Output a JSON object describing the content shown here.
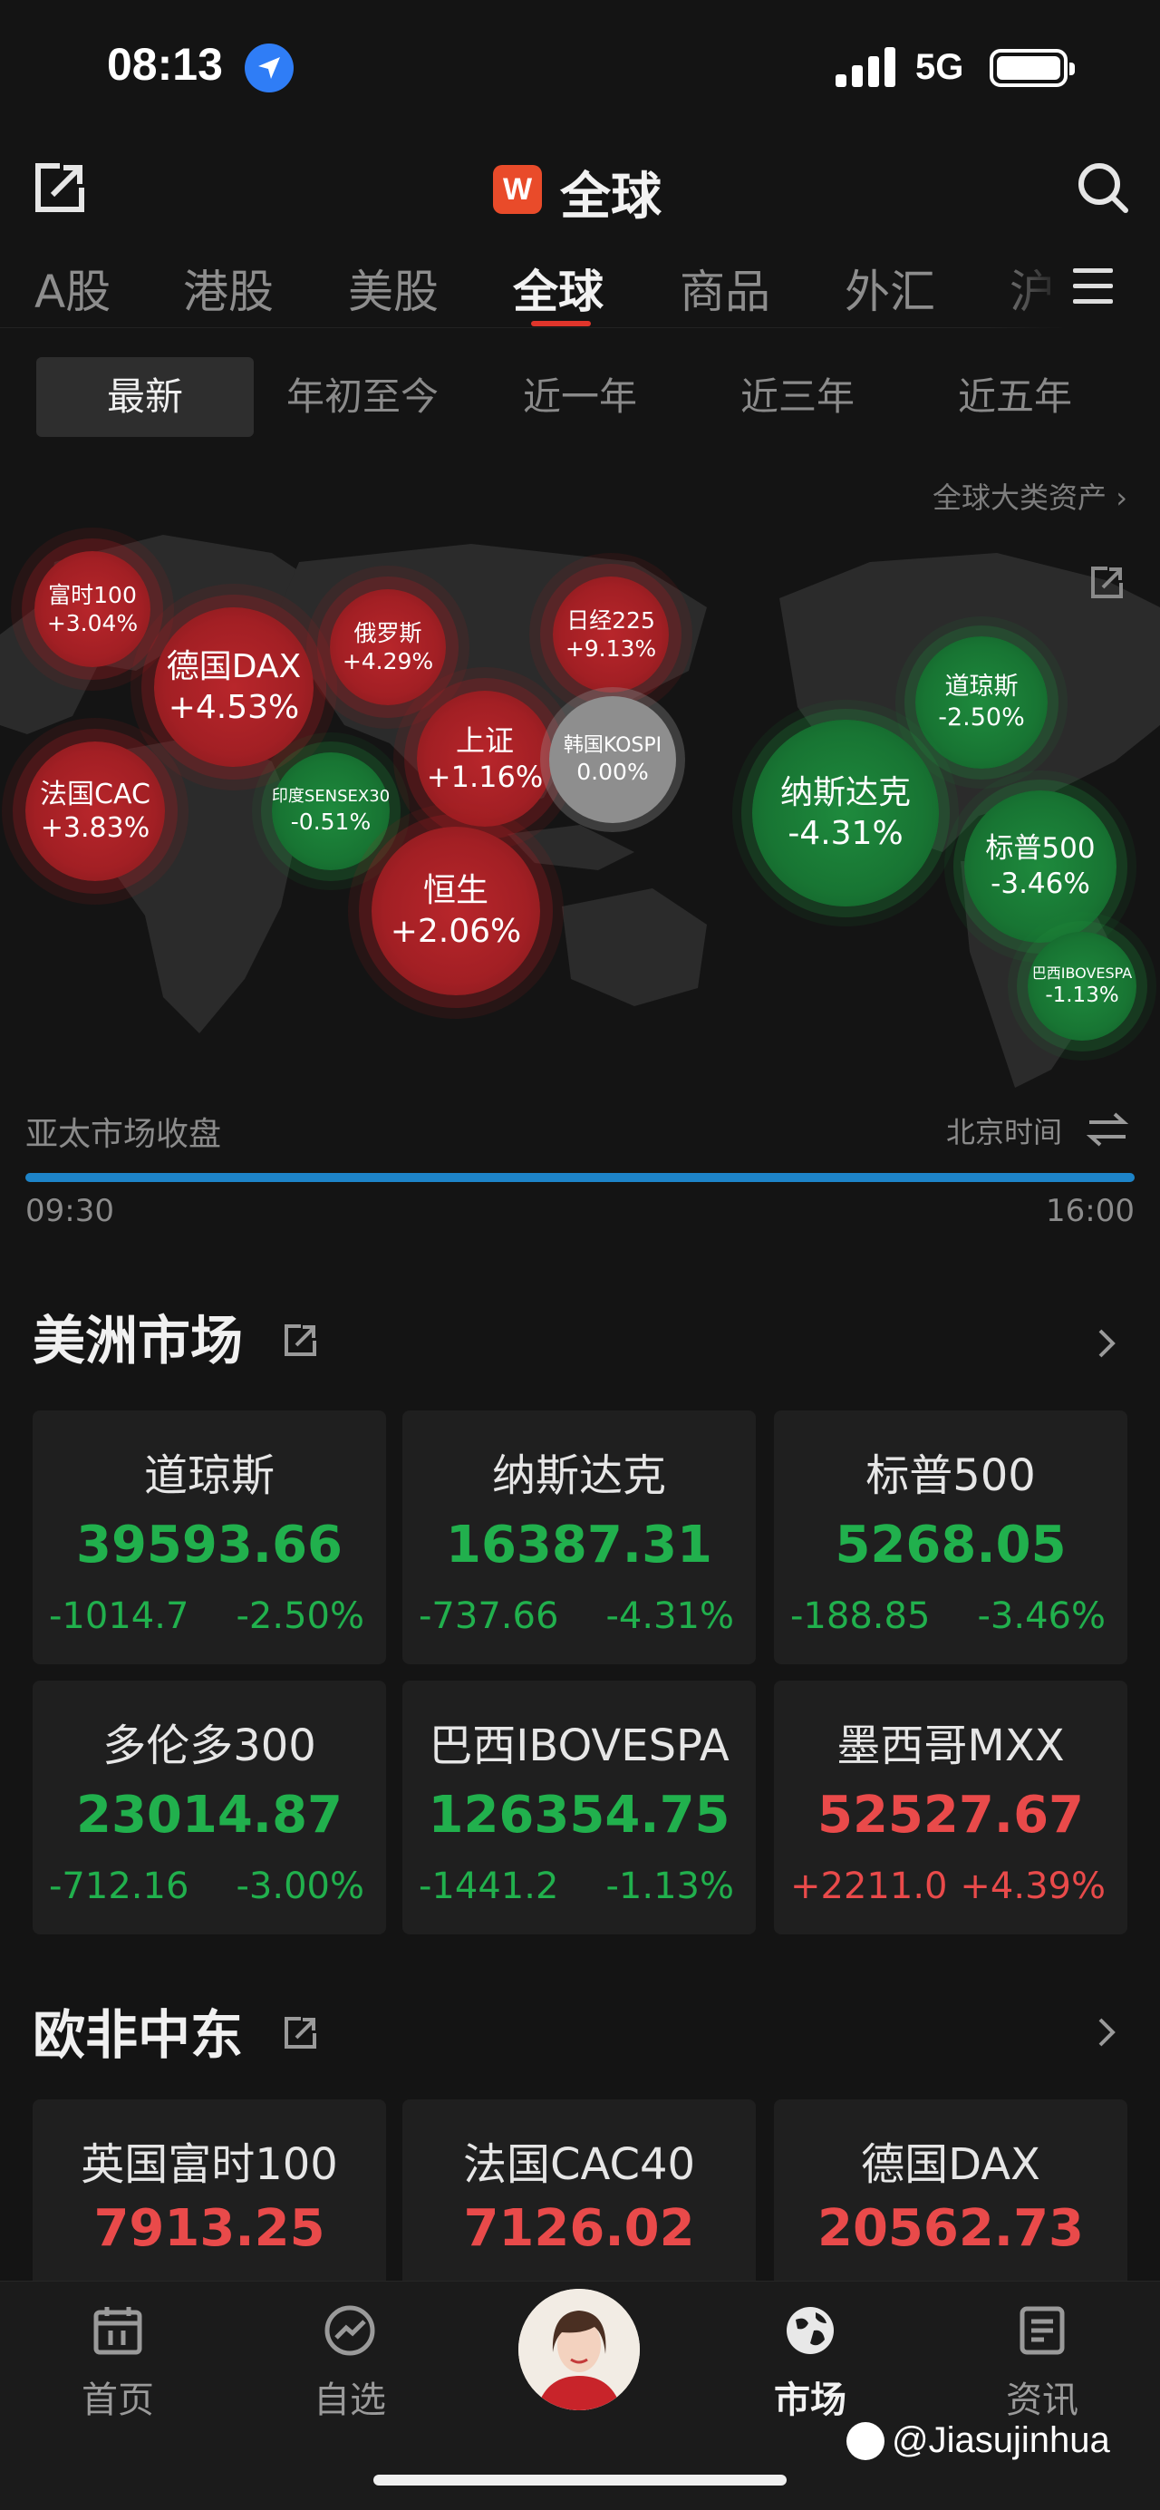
{
  "status_bar": {
    "time": "08:13",
    "network": "5G"
  },
  "header": {
    "brand_letter": "W",
    "title": "全球"
  },
  "market_tabs": [
    {
      "label": "A股",
      "active": false
    },
    {
      "label": "港股",
      "active": false
    },
    {
      "label": "美股",
      "active": false
    },
    {
      "label": "全球",
      "active": true
    },
    {
      "label": "商品",
      "active": false
    },
    {
      "label": "外汇",
      "active": false
    },
    {
      "label": "沪",
      "active": false
    }
  ],
  "periods": [
    {
      "label": "最新",
      "active": true
    },
    {
      "label": "年初至今",
      "active": false
    },
    {
      "label": "近一年",
      "active": false
    },
    {
      "label": "近三年",
      "active": false
    },
    {
      "label": "近五年",
      "active": false
    }
  ],
  "asset_link": "全球大类资产 ›",
  "map_indices": [
    {
      "name": "富时100",
      "change": "+3.04%",
      "trend": "up"
    },
    {
      "name": "德国DAX",
      "change": "+4.53%",
      "trend": "up"
    },
    {
      "name": "俄罗斯",
      "change": "+4.29%",
      "trend": "up"
    },
    {
      "name": "日经225",
      "change": "+9.13%",
      "trend": "up"
    },
    {
      "name": "法国CAC",
      "change": "+3.83%",
      "trend": "up"
    },
    {
      "name": "印度SENSEX30",
      "change": "-0.51%",
      "trend": "down"
    },
    {
      "name": "上证",
      "change": "+1.16%",
      "trend": "up"
    },
    {
      "name": "韩国KOSPI",
      "change": "0.00%",
      "trend": "flat"
    },
    {
      "name": "恒生",
      "change": "+2.06%",
      "trend": "up"
    },
    {
      "name": "道琼斯",
      "change": "-2.50%",
      "trend": "down"
    },
    {
      "name": "纳斯达克",
      "change": "-4.31%",
      "trend": "down"
    },
    {
      "name": "标普500",
      "change": "-3.46%",
      "trend": "down"
    },
    {
      "name": "巴西IBOVESPA",
      "change": "-1.13%",
      "trend": "down"
    }
  ],
  "session": {
    "label": "亚太市场收盘",
    "clock_label": "北京时间",
    "open_time": "09:30",
    "close_time": "16:00",
    "progress": 1.0
  },
  "americas": {
    "title": "美洲市场",
    "cards": [
      {
        "name": "道琼斯",
        "price": "39593.66",
        "change": "-1014.7",
        "pct": "-2.50%",
        "trend": "down"
      },
      {
        "name": "纳斯达克",
        "price": "16387.31",
        "change": "-737.66",
        "pct": "-4.31%",
        "trend": "down"
      },
      {
        "name": "标普500",
        "price": "5268.05",
        "change": "-188.85",
        "pct": "-3.46%",
        "trend": "down"
      },
      {
        "name": "多伦多300",
        "price": "23014.87",
        "change": "-712.16",
        "pct": "-3.00%",
        "trend": "down"
      },
      {
        "name": "巴西IBOVESPA",
        "price": "126354.75",
        "change": "-1441.2",
        "pct": "-1.13%",
        "trend": "down"
      },
      {
        "name": "墨西哥MXX",
        "price": "52527.67",
        "change": "+2211.0",
        "pct": "+4.39%",
        "trend": "up"
      }
    ]
  },
  "emea": {
    "title": "欧非中东",
    "cards": [
      {
        "name": "英国富时100",
        "price": "7913.25",
        "trend": "up"
      },
      {
        "name": "法国CAC40",
        "price": "7126.02",
        "trend": "up"
      },
      {
        "name": "德国DAX",
        "price": "20562.73",
        "trend": "up"
      }
    ]
  },
  "bottom_nav": [
    {
      "label": "首页",
      "icon": "calendar-icon",
      "active": false
    },
    {
      "label": "自选",
      "icon": "trend-icon",
      "active": false
    },
    {
      "label": "市场",
      "icon": "globe-icon",
      "active": true
    },
    {
      "label": "资讯",
      "icon": "news-icon",
      "active": false
    }
  ],
  "watermark": "@Jiasujinhua",
  "colors": {
    "up": "#e94a4a",
    "down": "#21b04d",
    "accent": "#e0352b",
    "progress": "#1d84c9"
  }
}
